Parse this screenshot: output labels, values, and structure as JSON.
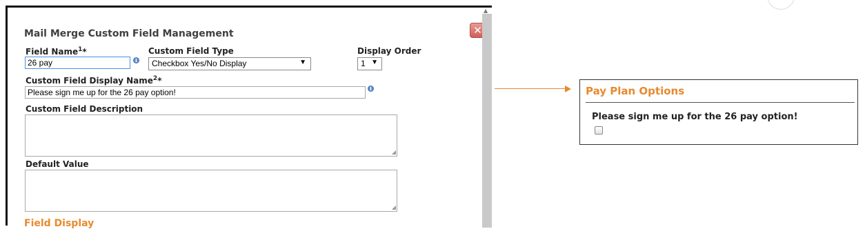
{
  "dialog": {
    "title": "Mail Merge Custom Field Management",
    "close_icon": "close-icon",
    "field_name": {
      "label": "Field Name",
      "sup": "1",
      "required": "*",
      "value": "26 pay"
    },
    "custom_field_type": {
      "label": "Custom Field Type",
      "selected": "Checkbox Yes/No Display"
    },
    "display_order": {
      "label": "Display Order",
      "selected": "1"
    },
    "display_name": {
      "label": "Custom Field Display Name",
      "sup": "2",
      "required": "*",
      "value": "Please sign me up for the 26 pay option!"
    },
    "description": {
      "label": "Custom Field Description",
      "value": ""
    },
    "default_value": {
      "label": "Default Value",
      "value": ""
    },
    "info_glyph": "i",
    "cut_off_heading": "Field Display"
  },
  "preview": {
    "title": "Pay Plan Options",
    "question": "Please sign me up for the 26 pay option!",
    "checkbox_checked": false
  },
  "colors": {
    "accent": "#e88a2e",
    "close": "#cf6058",
    "info": "#2f5fa8"
  }
}
